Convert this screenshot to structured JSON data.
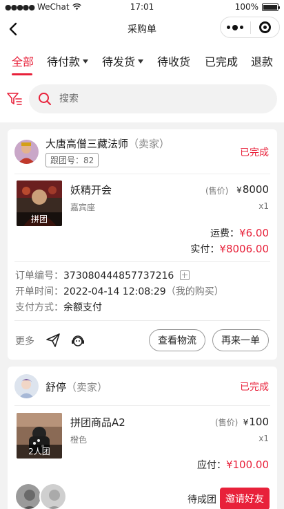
{
  "status_bar": {
    "carrier": "WeChat",
    "time": "17:01",
    "battery": "100%"
  },
  "nav": {
    "title": "采购单"
  },
  "tabs": [
    {
      "label": "全部",
      "active": true
    },
    {
      "label": "待付款",
      "dropdown": true
    },
    {
      "label": "待发货",
      "dropdown": true
    },
    {
      "label": "待收货"
    },
    {
      "label": "已完成"
    },
    {
      "label": "退款"
    }
  ],
  "search": {
    "placeholder": "搜索"
  },
  "orders": [
    {
      "seller": "大唐高僧三藏法师",
      "seller_role": "（卖家）",
      "group_no": "跟团号：82",
      "status": "已完成",
      "product": {
        "name": "妖精开会",
        "spec": "嘉宾座",
        "thumb_label": "拼团",
        "price_tag": "(售价)",
        "currency": "¥",
        "price": "8000",
        "qty": "x1"
      },
      "shipping_label": "运费：",
      "shipping": "¥6.00",
      "paid_label": "实付：",
      "paid": "¥8006.00",
      "order_no_label": "订单编号：",
      "order_no": "373080444857737216",
      "open_time_label": "开单时间：",
      "open_time": "2022-04-14 12:08:29",
      "open_note": "（我的购买）",
      "pay_label": "支付方式：",
      "pay_method": "余额支付",
      "more": "更多",
      "btn_logistics": "查看物流",
      "btn_reorder": "再来一单"
    },
    {
      "seller": "舒停",
      "seller_role": "（卖家）",
      "status": "已完成",
      "product": {
        "name": "拼团商品A2",
        "spec": "橙色",
        "thumb_label": "2人团",
        "price_tag": "(售价)",
        "currency": "¥",
        "price": "100",
        "qty": "x1"
      },
      "due_label": "应付：",
      "due": "¥100.00",
      "group_status": "待成团",
      "btn_invite": "邀请好友"
    }
  ],
  "colors": {
    "accent": "#e8213a",
    "background": "#f2f2f2"
  }
}
